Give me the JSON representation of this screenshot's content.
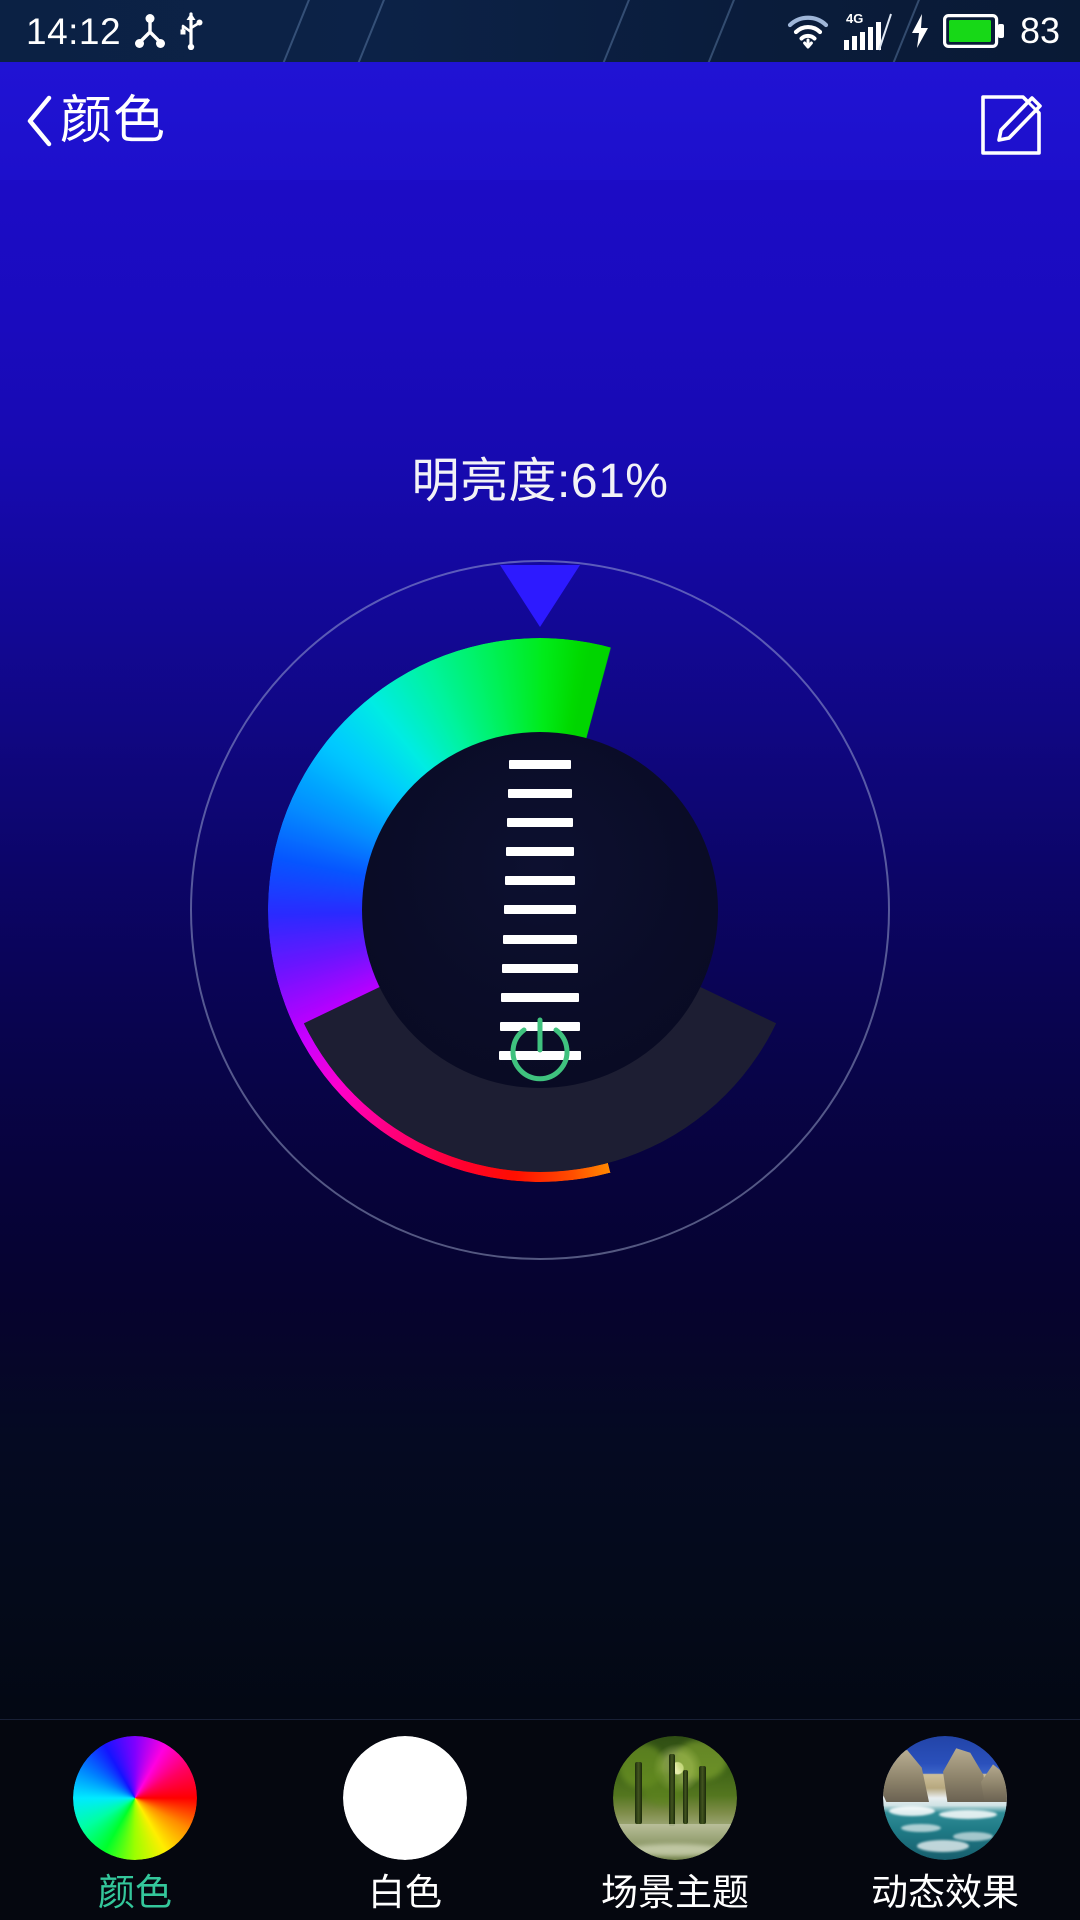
{
  "status_bar": {
    "time": "14:12",
    "battery_percent": "83",
    "icons": [
      {
        "name": "bluetooth-share-icon"
      },
      {
        "name": "usb-icon"
      },
      {
        "name": "wifi-icon"
      },
      {
        "name": "signal-4g-icon",
        "label": "4G"
      },
      {
        "name": "charging-bolt-icon"
      },
      {
        "name": "battery-icon"
      }
    ],
    "bg_color": "#0b2144"
  },
  "header": {
    "title": "颜色",
    "back_icon": "chevron-left-icon",
    "edit_icon": "edit-pencil-icon",
    "bg_color": "#2013d4"
  },
  "main": {
    "brightness_label": "明亮度:61%",
    "brightness_value": 61,
    "dial": {
      "pointer_icon": "triangle-down-indicator",
      "pointer_color": "#2d1aff",
      "outer_circle_color": "#b4c0e1",
      "ladder_rungs": 11,
      "power_icon": "power-icon",
      "power_color": "#3fc27e",
      "hue_start_color": "#ff8a00",
      "hue_end_color": "#05d200"
    }
  },
  "tabbar": {
    "active_index": 0,
    "active_color": "#34c79b",
    "items": [
      {
        "label": "颜色",
        "icon": "color-wheel-icon"
      },
      {
        "label": "白色",
        "icon": "white-circle-icon"
      },
      {
        "label": "场景主题",
        "icon": "scene-theme-forest-icon"
      },
      {
        "label": "动态效果",
        "icon": "dynamic-effect-beach-icon"
      }
    ]
  }
}
